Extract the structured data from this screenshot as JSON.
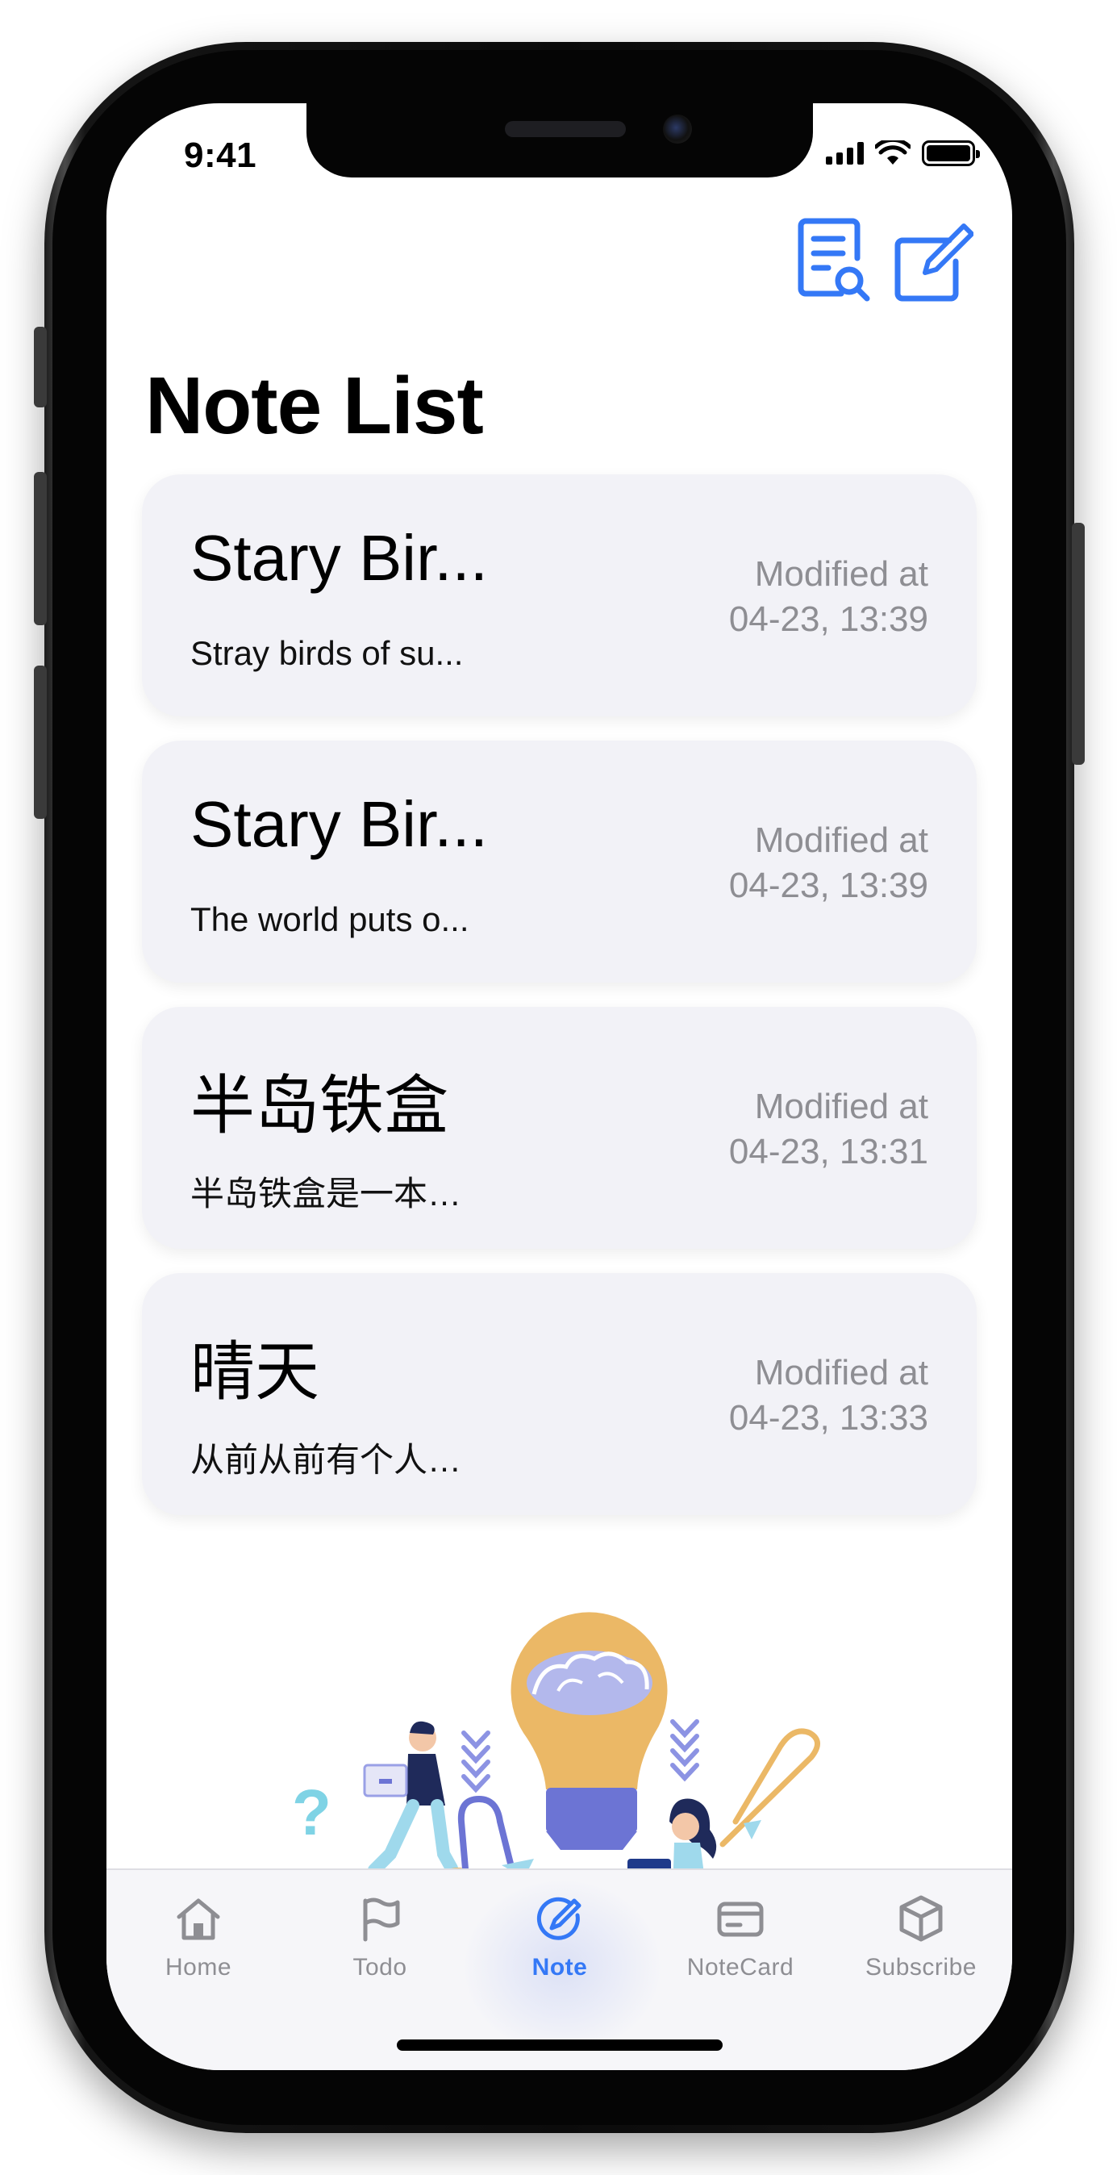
{
  "status_bar": {
    "time": "9:41"
  },
  "header": {
    "title": "Note List",
    "actions": [
      {
        "name": "search-notes",
        "icon": "document-search-icon"
      },
      {
        "name": "compose-note",
        "icon": "compose-icon"
      }
    ]
  },
  "notes": [
    {
      "title": "Stary Bir...",
      "preview": "Stray birds of su...",
      "modified_label": "Modified at",
      "modified_time": "04-23, 13:39"
    },
    {
      "title": "Stary Bir...",
      "preview": "The world puts o...",
      "modified_label": "Modified at",
      "modified_time": "04-23, 13:39"
    },
    {
      "title": "半岛铁盒",
      "preview": "半岛铁盒是一本…",
      "modified_label": "Modified at",
      "modified_time": "04-23, 13:31"
    },
    {
      "title": "晴天",
      "preview": "从前从前有个人…",
      "modified_label": "Modified at",
      "modified_time": "04-23, 13:33"
    }
  ],
  "illustration": {
    "question_mark": "?"
  },
  "tabs": [
    {
      "label": "Home",
      "icon": "house-icon",
      "active": false
    },
    {
      "label": "Todo",
      "icon": "flag-icon",
      "active": false
    },
    {
      "label": "Note",
      "icon": "pencil-circle-icon",
      "active": true
    },
    {
      "label": "NoteCard",
      "icon": "card-icon",
      "active": false
    },
    {
      "label": "Subscribe",
      "icon": "box-icon",
      "active": false
    }
  ],
  "colors": {
    "accent": "#3478f6",
    "card_background": "#f2f2f7",
    "secondary_text": "#8e8e93",
    "bulb_yellow": "#ebb866",
    "illustration_purple": "#6c74d4"
  }
}
